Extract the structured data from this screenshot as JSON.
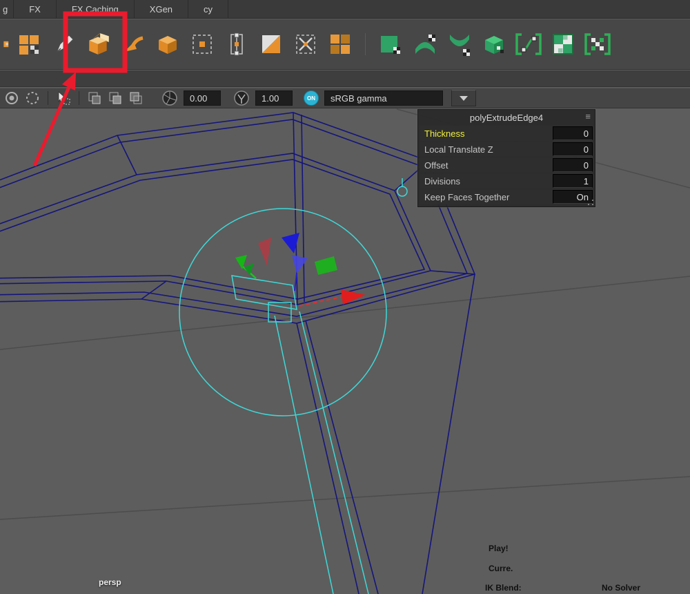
{
  "tabs": {
    "items": [
      "g",
      "FX",
      "FX Caching",
      "XGen",
      "cy"
    ]
  },
  "shelf": {
    "tools": [
      "append-polygon",
      "multi-cut",
      "extrude",
      "bevel-arrow",
      "cube",
      "center-target",
      "insert-edge-loop",
      "split-face",
      "delete-edge",
      "quad-draw",
      "sculpt-square",
      "sculpt-wave",
      "sculpt-flatten",
      "sculpt-cube",
      "wrap-curve",
      "texture-grid",
      "wrap-cross"
    ],
    "highlighted_tool": "extrude"
  },
  "viewport_toolbar": {
    "icons": [
      "no-live-surface",
      "symmetry",
      "select-tool",
      "layer-copy",
      "layer-paste",
      "layer-snapshot",
      "exposure",
      "gamma",
      "view-transform-toggle",
      "chevron-down"
    ],
    "exposure_value": "0.00",
    "gamma_value": "1.00",
    "toggle_label": "ON",
    "color_space": "sRGB gamma"
  },
  "hud": {
    "title": "polyExtrudeEdge4",
    "menu_glyph": "≡",
    "rows": [
      {
        "label": "Thickness",
        "value": "0",
        "highlighted": true
      },
      {
        "label": "Local Translate Z",
        "value": "0",
        "highlighted": false
      },
      {
        "label": "Offset",
        "value": "0",
        "highlighted": false
      },
      {
        "label": "Divisions",
        "value": "1",
        "highlighted": false
      },
      {
        "label": "Keep Faces Together",
        "value": "On",
        "highlighted": false
      }
    ]
  },
  "viewport": {
    "camera_label": "persp"
  },
  "status": {
    "play": "Play!",
    "current": "Curre.",
    "ik_blend": "IK Blend:",
    "solver": "No Solver"
  },
  "colors": {
    "accent_orange": "#e8912c",
    "accent_green": "#2fa266",
    "wireframe_navy": "#15157d",
    "manipulator_cyan": "#3fd8d8",
    "annotation_red": "#ea1b2d",
    "hud_highlight_yellow": "#f0f03c"
  }
}
